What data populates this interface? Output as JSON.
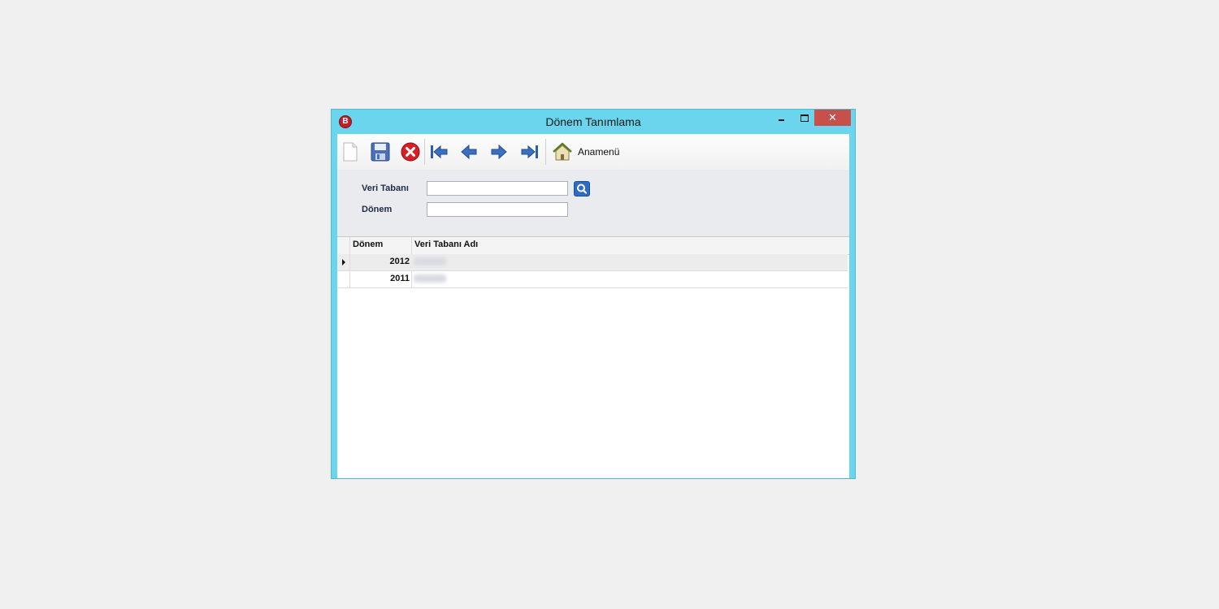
{
  "window": {
    "title": "Dönem Tanımlama",
    "app_icon_letter": "B",
    "close_glyph": "✕"
  },
  "toolbar": {
    "home_label": "Anamenü",
    "icons": [
      "new-document-icon",
      "save-icon",
      "delete-icon",
      "first-record-icon",
      "previous-record-icon",
      "next-record-icon",
      "last-record-icon",
      "home-icon"
    ]
  },
  "form": {
    "database_label": "Veri Tabanı",
    "database_value": "",
    "period_label": "Dönem",
    "period_value": ""
  },
  "grid": {
    "columns": [
      "Dönem",
      "Veri Tabanı Adı"
    ],
    "rows": [
      {
        "period": "2012",
        "selected": true
      },
      {
        "period": "2011",
        "selected": false
      }
    ]
  },
  "colors": {
    "window_border": "#6ad5ec",
    "close_button": "#c7504b",
    "panel": "#e9ebef"
  }
}
